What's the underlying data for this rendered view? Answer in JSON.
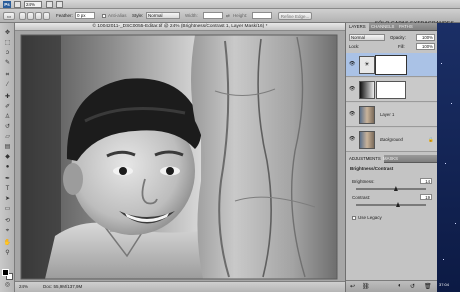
{
  "app": {
    "workspace_label": "SÓLO CAPAS EXTRAGRANDES"
  },
  "options_bar": {
    "zoom": "24%",
    "feather_label": "Feather:",
    "feather_value": "0 px",
    "antialias_label": "Anti-alias",
    "style_label": "Style:",
    "style_value": "Normal",
    "width_label": "Width:",
    "height_label": "Height:",
    "refine_edge": "Refine Edge..."
  },
  "document": {
    "title": "© 10042011-_DSC0055-Editar.tif @ 24% (Brightness/Contrast 1, Layer Mask/16) *",
    "zoom_status": "24%",
    "doc_size": "Doc: 55,9M/137,9M"
  },
  "layers_panel": {
    "tabs": [
      "LAYERS",
      "CHANNELS",
      "PATHS"
    ],
    "blend_mode": "Normal",
    "opacity_label": "Opacity:",
    "opacity_value": "100%",
    "lock_label": "Lock:",
    "fill_label": "Fill:",
    "fill_value": "100%",
    "layers": [
      {
        "name": "",
        "selected": true
      },
      {
        "name": "",
        "selected": false
      },
      {
        "name": "Layer 1",
        "selected": false
      },
      {
        "name": "Background",
        "selected": false
      }
    ]
  },
  "adjustments_panel": {
    "tabs": [
      "ADJUSTMENTS",
      "MASKS"
    ],
    "title": "Brightness/Contrast",
    "brightness_label": "Brightness:",
    "brightness_value": "14",
    "contrast_label": "Contrast:",
    "contrast_value": "19",
    "use_legacy_label": "Use Legacy",
    "brightness_level": 0.57,
    "contrast_level": 0.6
  },
  "desktop": {
    "clock": "37:04"
  },
  "colors": {
    "selected_layer": "#aac2e6",
    "desktop": "#142658"
  }
}
